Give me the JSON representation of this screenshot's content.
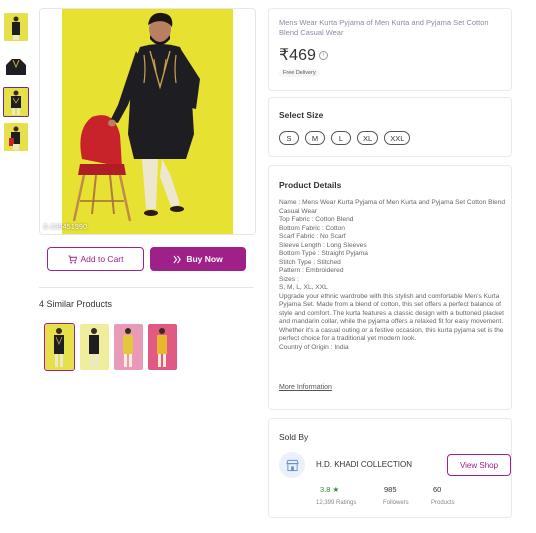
{
  "thumbnails": [
    {
      "name": "thumb-1",
      "selected": false
    },
    {
      "name": "thumb-2",
      "selected": false
    },
    {
      "name": "thumb-3",
      "selected": true
    },
    {
      "name": "thumb-4",
      "selected": false
    }
  ],
  "main_image": {
    "code": "S-239451990"
  },
  "actions": {
    "add_to_cart": "Add to Cart",
    "buy_now": "Buy Now"
  },
  "similar": {
    "title": "4 Similar Products"
  },
  "product": {
    "title": "Mens Wear Kurta Pyjama of Men Kurta and Pyjama Set Cotton Blend Casual Wear",
    "price": "₹469",
    "delivery": "Free Delivery"
  },
  "size_section": {
    "title": "Select Size",
    "sizes": [
      "S",
      "M",
      "L",
      "XL",
      "XXL"
    ]
  },
  "details_section": {
    "title": "Product Details",
    "lines": [
      "Name : Mens Wear Kurta Pyjama of Men Kurta and Pyjama Set Cotton Blend Casual Wear",
      "Top Fabric : Cotton Blend",
      "Bottom Fabric : Cotton",
      "Scarf Fabric : No Scarf",
      "Sleeve Length : Long Sleeves",
      "Bottom Type : Straight Pyjama",
      "Stitch Type : Stitched",
      "Pattern : Embroidered",
      "Sizes :",
      "S, M, L, XL, XXL"
    ],
    "description": "Upgrade your ethnic wardrobe with this stylish and comfortable Men's Kurta Pyjama Set. Made from a blend of cotton, this set offers a perfect balance of style and comfort. The kurta features a classic design with a buttoned placket and mandarin collar, while the pyjama offers a relaxed fit for easy movement. Whether it's a casual outing or a festive occasion, this kurta pyjama set is the perfect choice for a traditional yet modern look.",
    "origin": "Country of Origin : India",
    "more": "More Information"
  },
  "seller": {
    "section_title": "Sold By",
    "name": "H.D. KHADI COLLECTION",
    "view_shop": "View Shop",
    "rating": "3.8 ★",
    "ratings_label": "12,399 Ratings",
    "followers": "985",
    "followers_label": "Followers",
    "products": "60",
    "products_label": "Products"
  },
  "colors": {
    "accent": "#9f2089",
    "image_bg": "#e7e231",
    "kurta": "#1d1d22"
  }
}
